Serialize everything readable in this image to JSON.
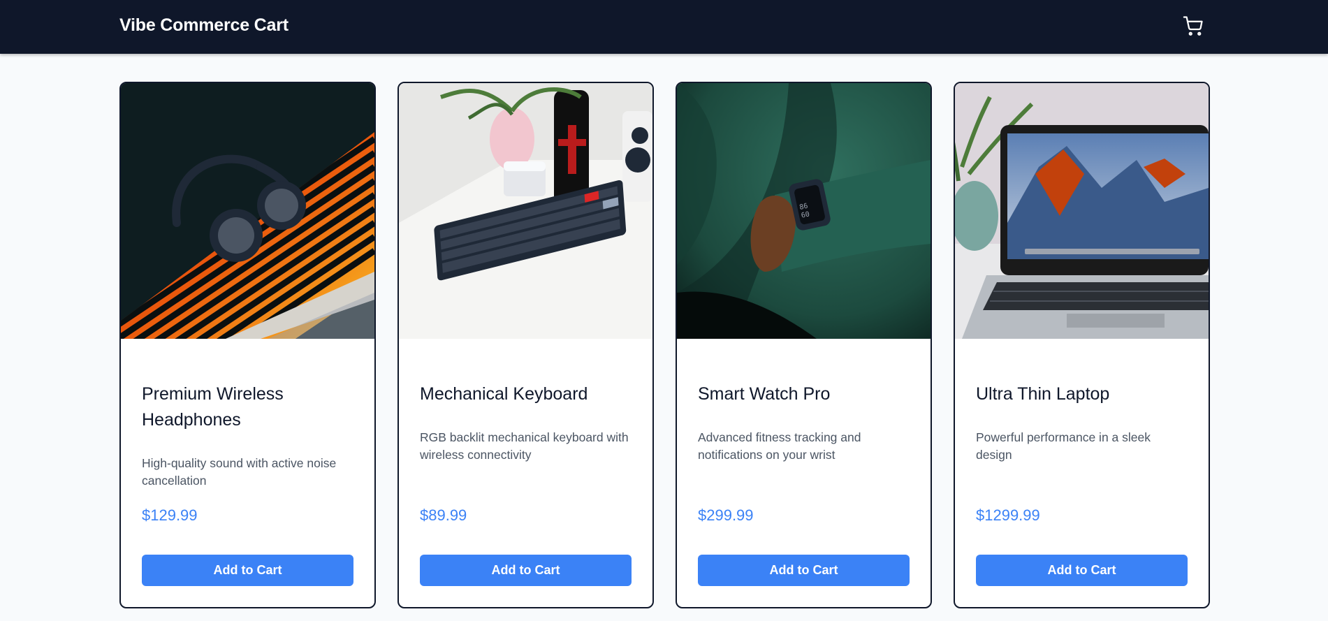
{
  "header": {
    "title": "Vibe Commerce Cart",
    "cart_icon": "shopping-cart-icon"
  },
  "colors": {
    "navbar": "#0f172a",
    "accent": "#3b82f6",
    "background": "#f8fafc"
  },
  "products": [
    {
      "title": "Premium Wireless Headphones",
      "description": "High-quality sound with active noise cancellation",
      "price": "$129.99",
      "button_label": "Add to Cart"
    },
    {
      "title": "Mechanical Keyboard",
      "description": "RGB backlit mechanical keyboard with wireless connectivity",
      "price": "$89.99",
      "button_label": "Add to Cart"
    },
    {
      "title": "Smart Watch Pro",
      "description": "Advanced fitness tracking and notifications on your wrist",
      "price": "$299.99",
      "button_label": "Add to Cart"
    },
    {
      "title": "Ultra Thin Laptop",
      "description": "Powerful performance in a sleek design",
      "price": "$1299.99",
      "button_label": "Add to Cart"
    }
  ]
}
